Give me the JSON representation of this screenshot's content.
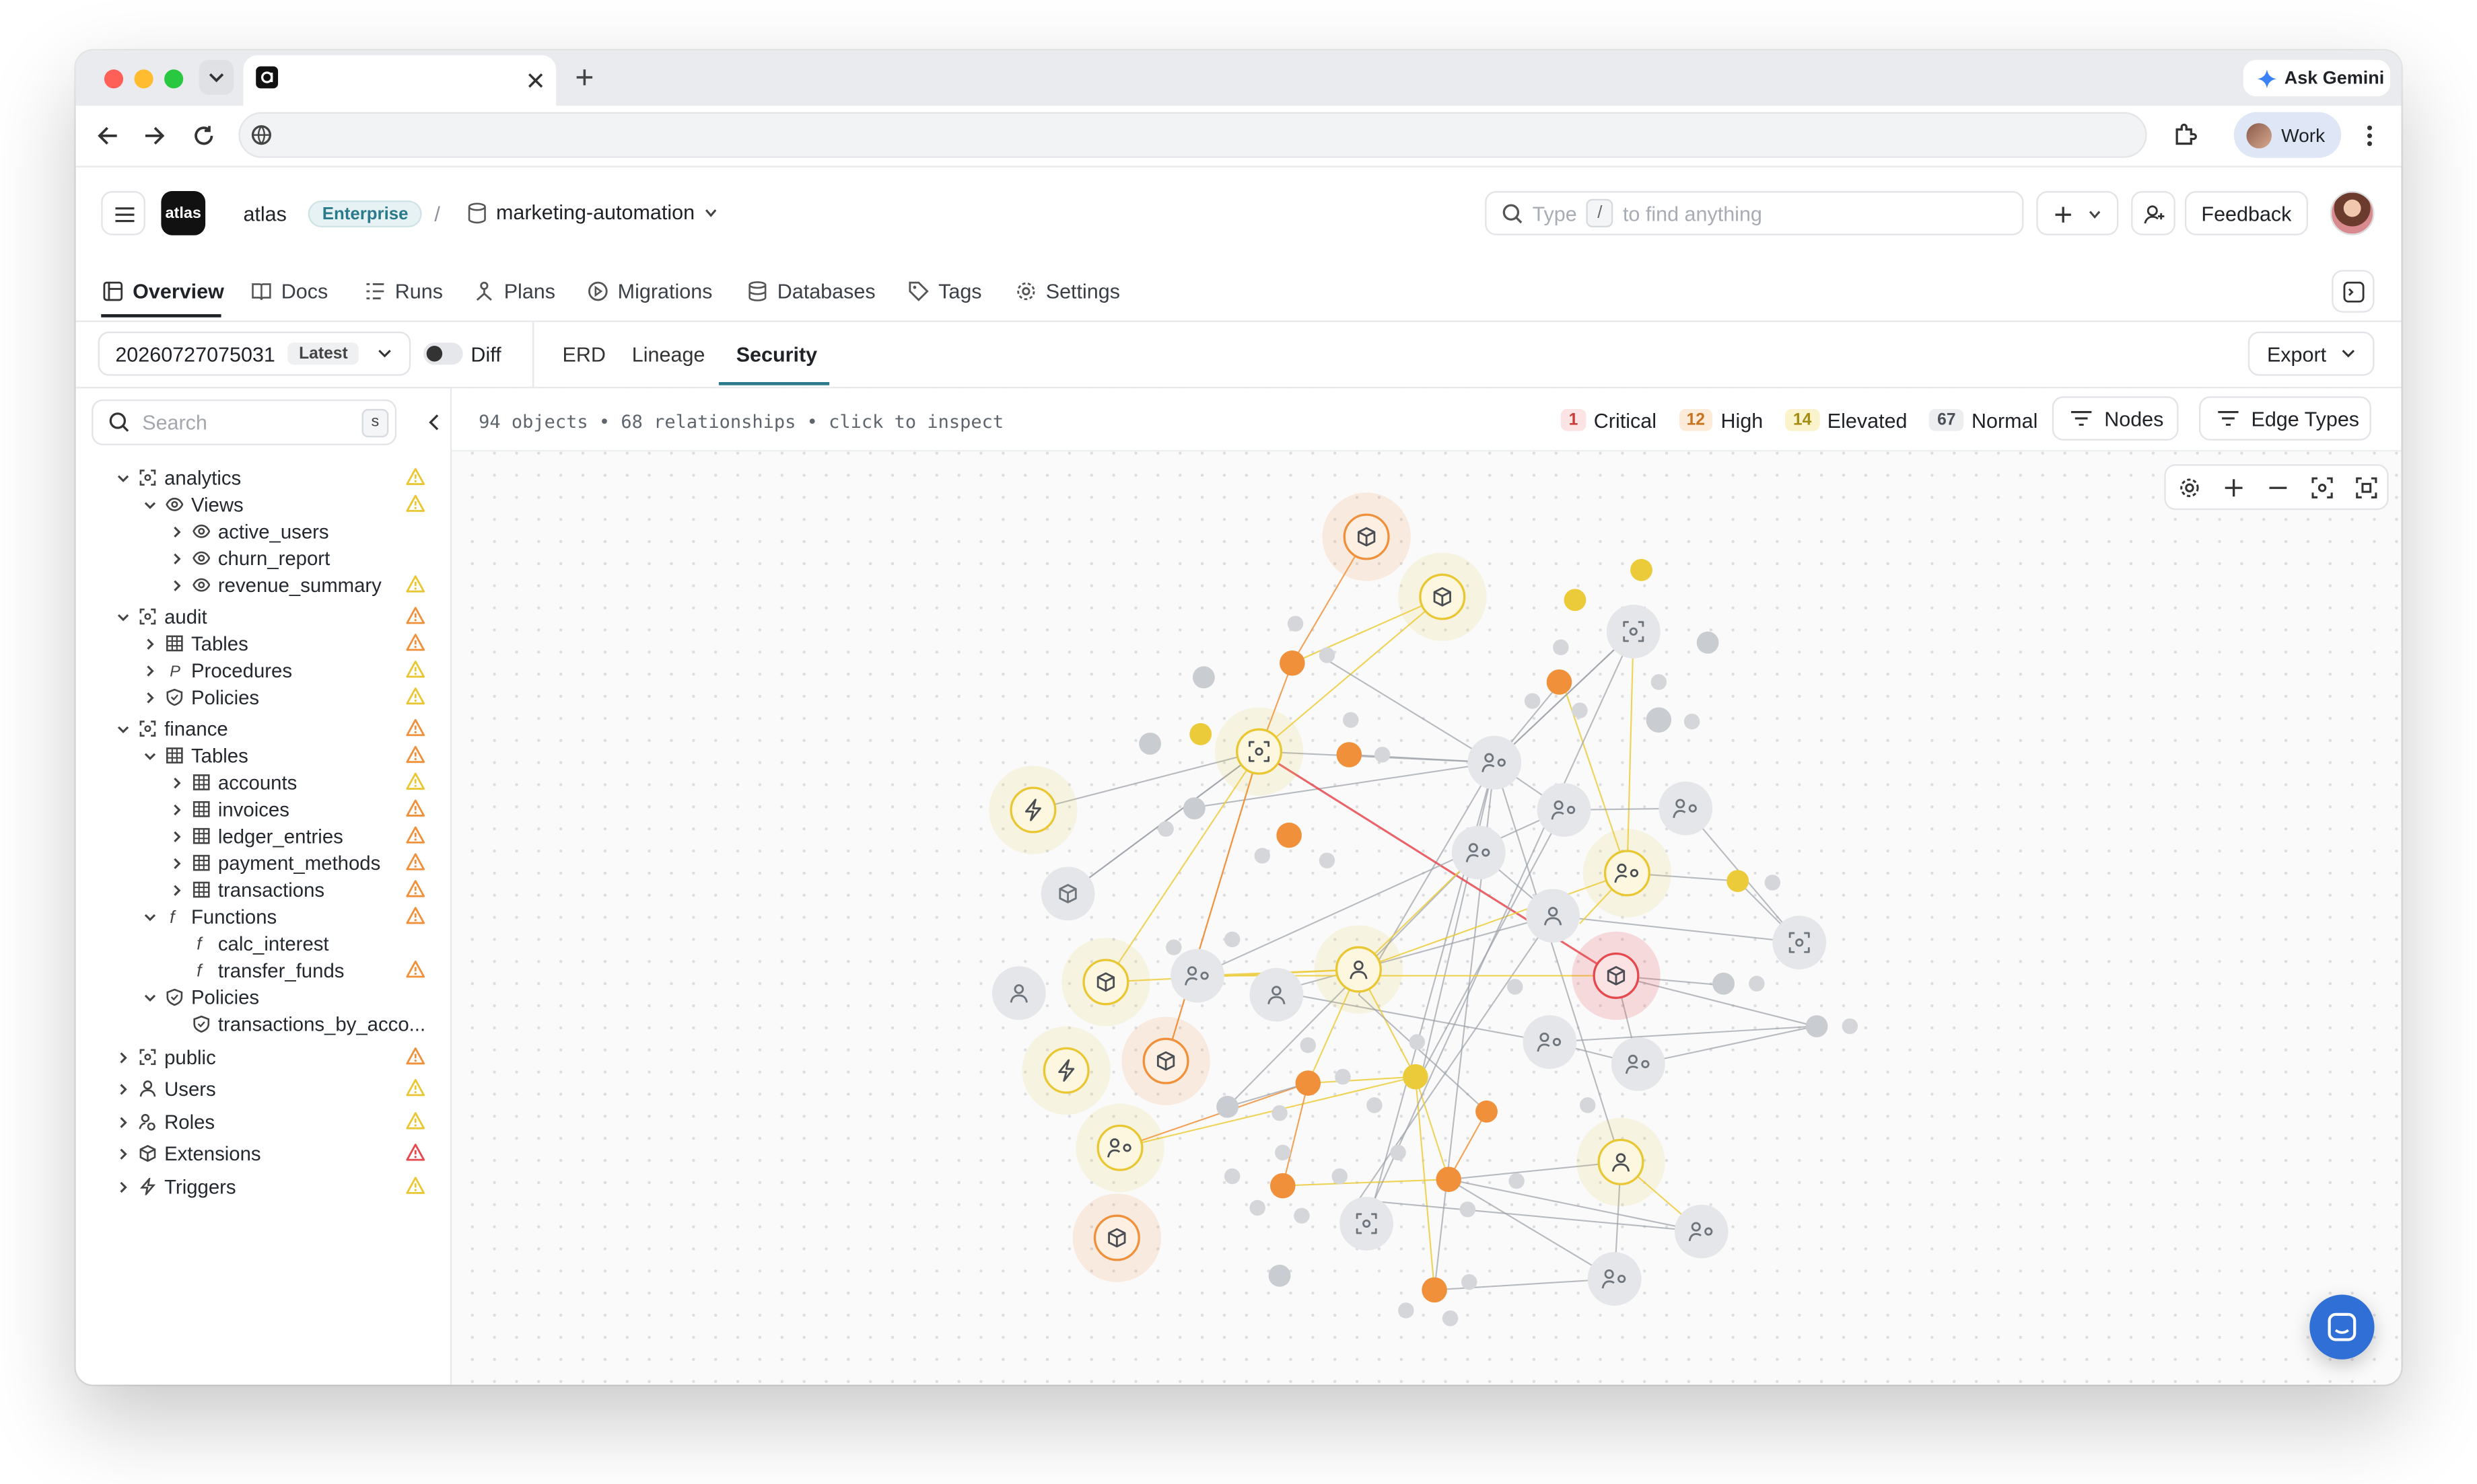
{
  "browser": {
    "ask_label": "Ask Gemini",
    "profile_label": "Work"
  },
  "header": {
    "org": "atlas",
    "logo_text": "atlas",
    "plan_badge": "Enterprise",
    "separator": "/",
    "project": "marketing-automation",
    "search_placeholder_before": "Type",
    "search_key": "/",
    "search_placeholder_after": "to find anything",
    "feedback_label": "Feedback"
  },
  "nav": {
    "tabs": [
      "Overview",
      "Docs",
      "Runs",
      "Plans",
      "Migrations",
      "Databases",
      "Tags",
      "Settings"
    ]
  },
  "toolbar": {
    "version": "20260727075031",
    "version_badge": "Latest",
    "diff_label": "Diff",
    "view_tabs": [
      "ERD",
      "Lineage",
      "Security"
    ],
    "active_view": "Security",
    "export_label": "Export"
  },
  "sidebar": {
    "search_placeholder": "Search",
    "search_key": "s",
    "tree": [
      {
        "label": "analytics",
        "warn": "yellow"
      },
      {
        "label": "Views",
        "warn": "yellow"
      },
      {
        "label": "active_users",
        "warn": ""
      },
      {
        "label": "churn_report",
        "warn": ""
      },
      {
        "label": "revenue_summary",
        "warn": "yellow"
      },
      {
        "label": "audit",
        "warn": "orange"
      },
      {
        "label": "Tables",
        "warn": "orange"
      },
      {
        "label": "Procedures",
        "warn": "yellow"
      },
      {
        "label": "Policies",
        "warn": "yellow"
      },
      {
        "label": "finance",
        "warn": "orange"
      },
      {
        "label": "Tables",
        "warn": "orange"
      },
      {
        "label": "accounts",
        "warn": "yellow"
      },
      {
        "label": "invoices",
        "warn": "orange"
      },
      {
        "label": "ledger_entries",
        "warn": "orange"
      },
      {
        "label": "payment_methods",
        "warn": "orange"
      },
      {
        "label": "transactions",
        "warn": "orange"
      },
      {
        "label": "Functions",
        "warn": "orange"
      },
      {
        "label": "calc_interest",
        "warn": ""
      },
      {
        "label": "transfer_funds",
        "warn": "orange"
      },
      {
        "label": "Policies",
        "warn": ""
      },
      {
        "label": "transactions_by_acco...",
        "warn": ""
      },
      {
        "label": "public",
        "warn": "orange"
      },
      {
        "label": "Users",
        "warn": "yellow"
      },
      {
        "label": "Roles",
        "warn": "yellow"
      },
      {
        "label": "Extensions",
        "warn": "red"
      },
      {
        "label": "Triggers",
        "warn": "yellow"
      }
    ]
  },
  "graph": {
    "summary": "94 objects • 68 relationships • click to inspect",
    "legend": [
      {
        "count": "1",
        "label": "Critical",
        "color": "#e5484d"
      },
      {
        "count": "12",
        "label": "High",
        "color": "#f0903a"
      },
      {
        "count": "14",
        "label": "Elevated",
        "color": "#e9c733"
      },
      {
        "count": "67",
        "label": "Normal",
        "color": "#9aa0a6"
      }
    ],
    "nodes_label": "Nodes",
    "edge_types_label": "Edge Types"
  },
  "colors": {
    "critical": "#e5484d",
    "high": "#f0903a",
    "elevated": "#eccb3a",
    "normal": "#c9ccd1",
    "accent": "#2b7a8c",
    "chat": "#2f6fd6"
  }
}
